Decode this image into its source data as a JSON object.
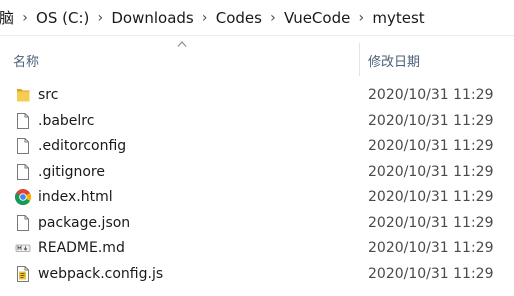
{
  "breadcrumb": {
    "items": [
      "脑",
      "OS (C:)",
      "Downloads",
      "Codes",
      "VueCode",
      "mytest"
    ],
    "separator": ">"
  },
  "columns": {
    "name": "名称",
    "date": "修改日期",
    "sort": "ascending"
  },
  "files": [
    {
      "name": "src",
      "date": "2020/10/31 11:29",
      "icon": "folder-icon"
    },
    {
      "name": ".babelrc",
      "date": "2020/10/31 11:29",
      "icon": "file-icon"
    },
    {
      "name": ".editorconfig",
      "date": "2020/10/31 11:29",
      "icon": "file-icon"
    },
    {
      "name": ".gitignore",
      "date": "2020/10/31 11:29",
      "icon": "file-icon"
    },
    {
      "name": "index.html",
      "date": "2020/10/31 11:29",
      "icon": "chrome-icon"
    },
    {
      "name": "package.json",
      "date": "2020/10/31 11:29",
      "icon": "file-icon"
    },
    {
      "name": "README.md",
      "date": "2020/10/31 11:29",
      "icon": "markdown-icon"
    },
    {
      "name": "webpack.config.js",
      "date": "2020/10/31 11:29",
      "icon": "js-script-icon"
    }
  ],
  "colors": {
    "folder": "#f0c040",
    "header_text": "#4c607a"
  }
}
